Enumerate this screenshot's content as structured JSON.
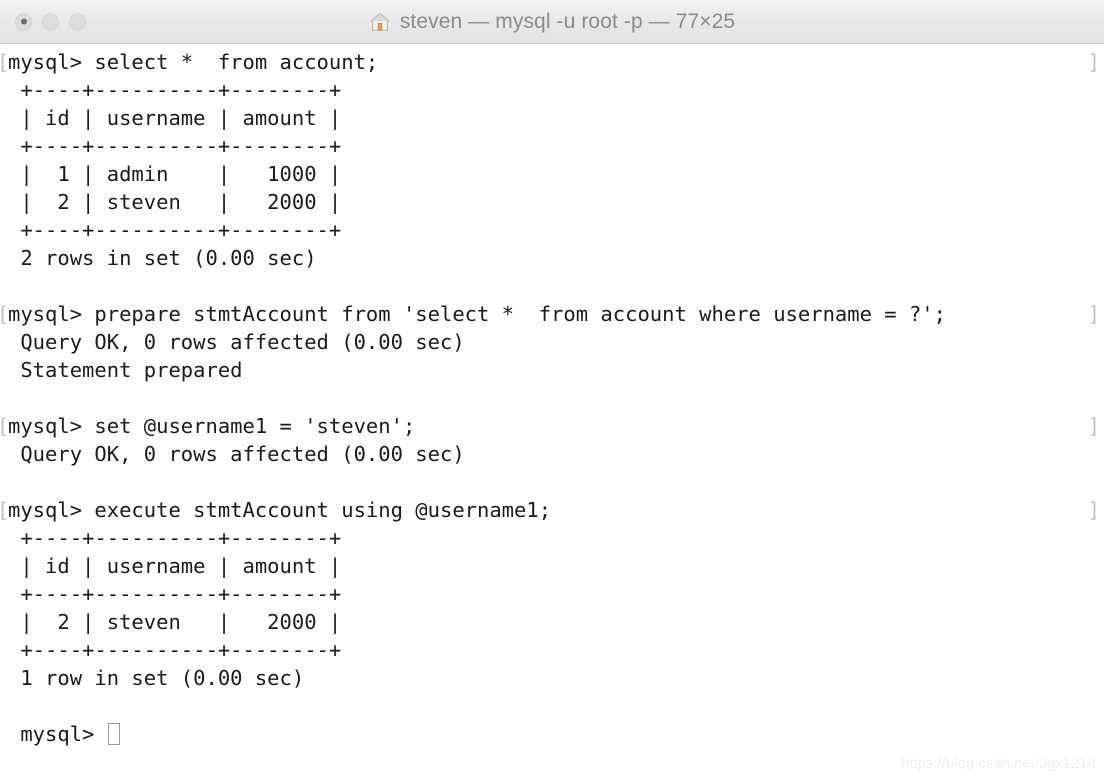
{
  "window": {
    "title": "steven — mysql -u root -p — 77×25",
    "icon": "house-icon",
    "traffic_lights": [
      {
        "name": "close",
        "label": ""
      },
      {
        "name": "minimize",
        "label": ""
      },
      {
        "name": "zoom",
        "label": ""
      }
    ]
  },
  "terminal": {
    "columns": 77,
    "rows": 25,
    "prompt": "mysql>",
    "foreground_color": "#1a1a1a",
    "background_color": "#ffffff",
    "mark_color": "#c0c0c0",
    "mark_left": "[",
    "mark_right": "]",
    "lines": [
      {
        "text": "[mysql> select *  from account;",
        "mark": true
      },
      {
        "text": " +----+----------+--------+",
        "mark": false
      },
      {
        "text": " | id | username | amount |",
        "mark": false
      },
      {
        "text": " +----+----------+--------+",
        "mark": false
      },
      {
        "text": " |  1 | admin    |   1000 |",
        "mark": false
      },
      {
        "text": " |  2 | steven   |   2000 |",
        "mark": false
      },
      {
        "text": " +----+----------+--------+",
        "mark": false
      },
      {
        "text": " 2 rows in set (0.00 sec)",
        "mark": false
      },
      {
        "text": "",
        "mark": false
      },
      {
        "text": "[mysql> prepare stmtAccount from 'select *  from account where username = ?';",
        "mark": true
      },
      {
        "text": " Query OK, 0 rows affected (0.00 sec)",
        "mark": false
      },
      {
        "text": " Statement prepared",
        "mark": false
      },
      {
        "text": "",
        "mark": false
      },
      {
        "text": "[mysql> set @username1 = 'steven';",
        "mark": true
      },
      {
        "text": " Query OK, 0 rows affected (0.00 sec)",
        "mark": false
      },
      {
        "text": "",
        "mark": false
      },
      {
        "text": "[mysql> execute stmtAccount using @username1;",
        "mark": true
      },
      {
        "text": " +----+----------+--------+",
        "mark": false
      },
      {
        "text": " | id | username | amount |",
        "mark": false
      },
      {
        "text": " +----+----------+--------+",
        "mark": false
      },
      {
        "text": " |  2 | steven   |   2000 |",
        "mark": false
      },
      {
        "text": " +----+----------+--------+",
        "mark": false
      },
      {
        "text": " 1 row in set (0.00 sec)",
        "mark": false
      },
      {
        "text": "",
        "mark": false
      },
      {
        "text": " mysql> ",
        "mark": false,
        "cursor": true
      }
    ]
  },
  "watermark": {
    "text": "https://blog.csdn.net/Jgx1214"
  }
}
